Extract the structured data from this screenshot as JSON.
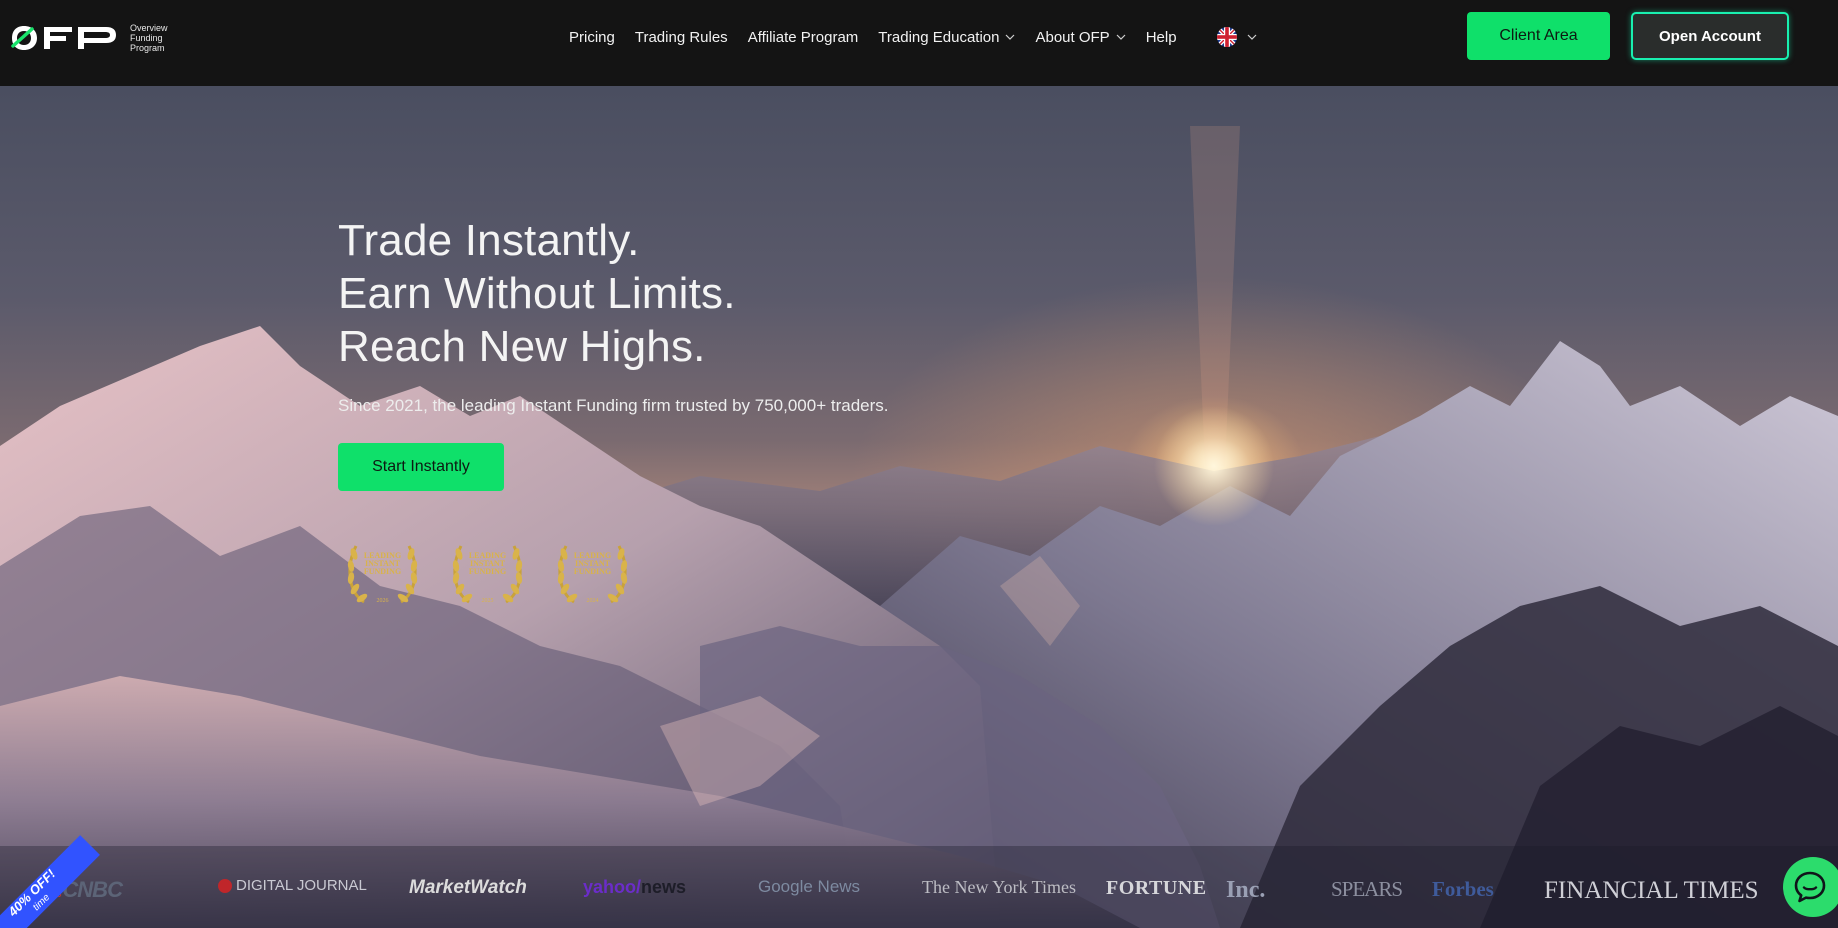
{
  "brand": {
    "logo_text": "OFP",
    "logo_sub": [
      "Overview",
      "Funding",
      "Program"
    ]
  },
  "nav": {
    "items": [
      {
        "label": "Pricing",
        "dropdown": false
      },
      {
        "label": "Trading Rules",
        "dropdown": false
      },
      {
        "label": "Affiliate Program",
        "dropdown": false
      },
      {
        "label": "Trading Education",
        "dropdown": true
      },
      {
        "label": "About OFP",
        "dropdown": true
      },
      {
        "label": "Help",
        "dropdown": false
      }
    ],
    "language_icon": "uk-flag-icon"
  },
  "header_buttons": {
    "client_area": "Client Area",
    "open_account": "Open Account"
  },
  "hero": {
    "title_lines": [
      "Trade Instantly.",
      "Earn Without Limits.",
      "Reach New Highs."
    ],
    "subtitle": "Since 2021, the leading Instant Funding firm trusted by 750,000+ traders.",
    "cta": "Start Instantly"
  },
  "awards": [
    {
      "line1": "LEADING",
      "line2": "INSTANT",
      "line3": "FUNDING",
      "year": "2026"
    },
    {
      "line1": "LEADING",
      "line2": "INSTANT",
      "line3": "FUNDING",
      "year": "2025"
    },
    {
      "line1": "LEADING",
      "line2": "INSTANT",
      "line3": "FUNDING",
      "year": "2024"
    }
  ],
  "press": {
    "cnbc": "CNBC",
    "digital_journal": "DIGITAL JOURNAL",
    "marketwatch": "MarketWatch",
    "yahoo": "yahoo/",
    "yahoo_news": "news",
    "google_news": "Google News",
    "nyt": "The New York Times",
    "fortune": "FORTUNE",
    "inc": "Inc.",
    "spears": "SPEARS",
    "forbes": "Forbes",
    "ft": "FINANCIAL TIMES"
  },
  "promo": {
    "label": "40% OFF!",
    "sub": "time"
  },
  "colors": {
    "accent_green": "#0fe06a",
    "outline_teal": "#19f0b0",
    "nav_bg": "#141414"
  }
}
